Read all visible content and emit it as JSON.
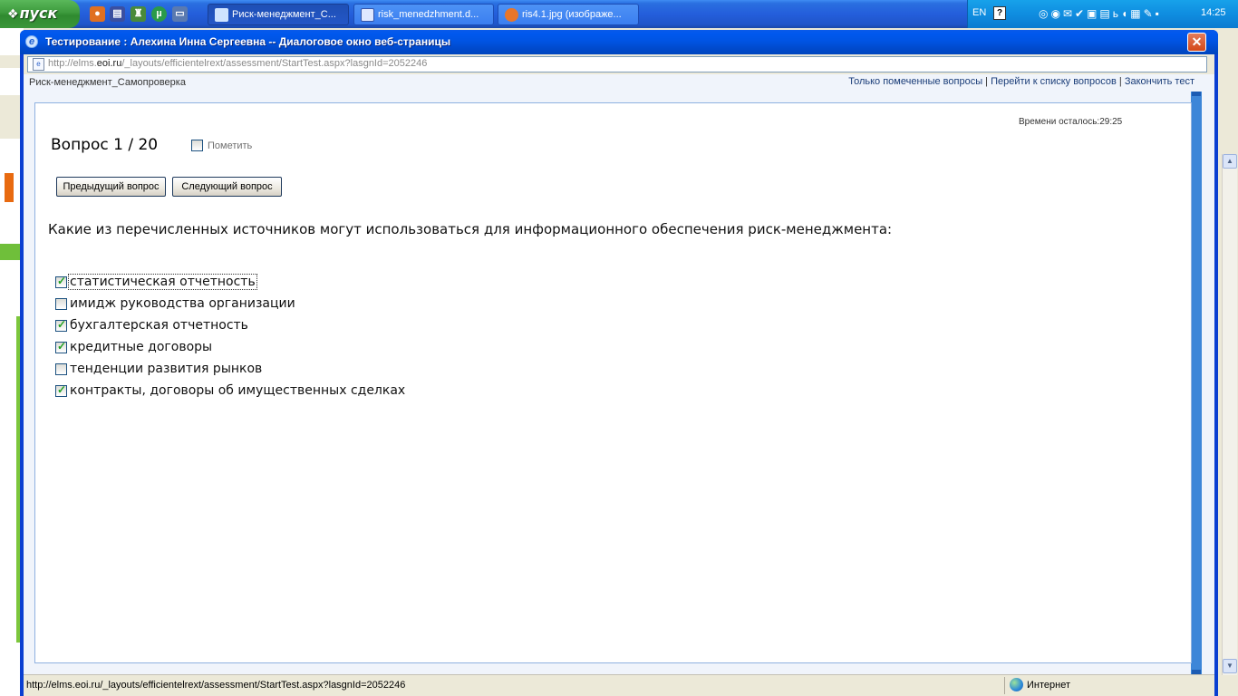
{
  "taskbar": {
    "start_label": "пуск",
    "tasks": [
      {
        "label": "Риск-менеджмент_С...",
        "active": true
      },
      {
        "label": "risk_menedzhment.d...",
        "active": false
      },
      {
        "label": "ris4.1.jpg (изображе...",
        "active": false
      }
    ],
    "language": "EN",
    "clock": "14:25"
  },
  "dialog": {
    "title": "Тестирование : Алехина Инна Сергеевна -- Диалоговое окно веб-страницы",
    "close_glyph": "✕",
    "address": {
      "prefix": "http://elms.",
      "domain": "eoi.ru",
      "path": "/_layouts/efficientelrext/assessment/StartTest.aspx?lasgnId=2052246"
    }
  },
  "header": {
    "course": "Риск-менеджмент_Самопроверка",
    "links": {
      "marked_only": "Только помеченные вопросы",
      "question_list": "Перейти к списку вопросов",
      "finish": "Закончить тест",
      "separator": " | "
    }
  },
  "test": {
    "timer": "Времени осталось:29:25",
    "question_number": "Вопрос 1 / 20",
    "mark_label": "Пометить",
    "prev_button": "Предыдущий вопрос",
    "next_button": "Следующий вопрос",
    "question": "Какие из перечисленных источников могут использоваться для информационного обеспечения риск-менеджмента:",
    "answers": [
      {
        "text": "статистическая отчетность",
        "checked": true
      },
      {
        "text": "имидж руководства организации",
        "checked": false
      },
      {
        "text": "бухгалтерская отчетность",
        "checked": true
      },
      {
        "text": "кредитные договоры",
        "checked": true
      },
      {
        "text": "тенденции развития рынков",
        "checked": false
      },
      {
        "text": "контракты, договоры об имущественных сделках",
        "checked": true
      }
    ]
  },
  "status_bar": {
    "url": "http://elms.eoi.ru/_layouts/efficientelrext/assessment/StartTest.aspx?lasgnId=2052246",
    "zone": "Интернет"
  },
  "colors": {
    "titlebar": "#0054e3",
    "taskbar": "#245edb",
    "start": "#3d9a3d",
    "checkmark": "#21a121"
  }
}
